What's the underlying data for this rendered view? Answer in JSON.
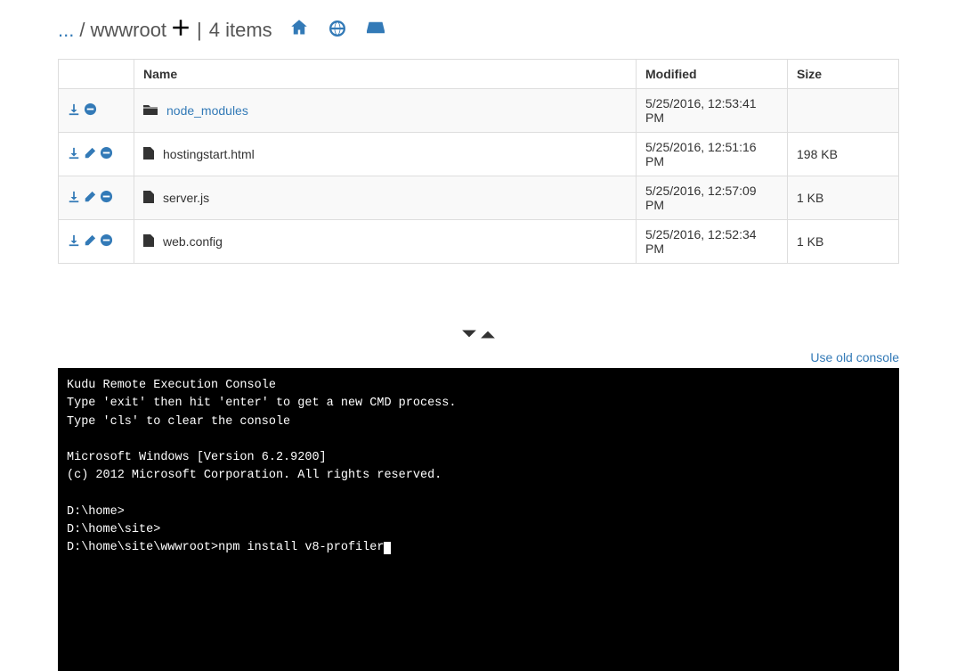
{
  "breadcrumb": {
    "ellipsis": "...",
    "separator": "/",
    "current": "wwwroot",
    "pipe": "|",
    "item_count": "4 items"
  },
  "table": {
    "headers": {
      "actions": "",
      "name": "Name",
      "modified": "Modified",
      "size": "Size"
    },
    "rows": [
      {
        "type": "folder",
        "name": "node_modules",
        "modified": "5/25/2016, 12:53:41 PM",
        "size": "",
        "actions": [
          "download",
          "delete"
        ]
      },
      {
        "type": "file",
        "name": "hostingstart.html",
        "modified": "5/25/2016, 12:51:16 PM",
        "size": "198 KB",
        "actions": [
          "download",
          "edit",
          "delete"
        ]
      },
      {
        "type": "file",
        "name": "server.js",
        "modified": "5/25/2016, 12:57:09 PM",
        "size": "1 KB",
        "actions": [
          "download",
          "edit",
          "delete"
        ]
      },
      {
        "type": "file",
        "name": "web.config",
        "modified": "5/25/2016, 12:52:34 PM",
        "size": "1 KB",
        "actions": [
          "download",
          "edit",
          "delete"
        ]
      }
    ]
  },
  "old_console_link": "Use old console",
  "console": {
    "lines": [
      "Kudu Remote Execution Console",
      "Type 'exit' then hit 'enter' to get a new CMD process.",
      "Type 'cls' to clear the console",
      "",
      "Microsoft Windows [Version 6.2.9200]",
      "(c) 2012 Microsoft Corporation. All rights reserved.",
      "",
      "D:\\home>",
      "D:\\home\\site>"
    ],
    "prompt": "D:\\home\\site\\wwwroot>",
    "input": "npm install v8-profiler"
  }
}
